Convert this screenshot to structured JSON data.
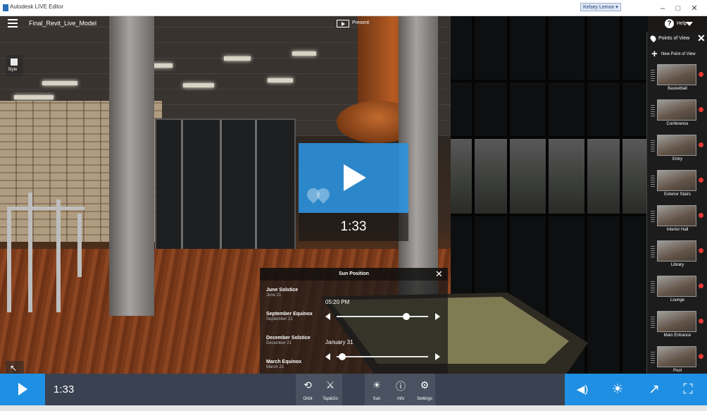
{
  "window": {
    "title": "Autodesk LIVE Editor",
    "user": "Kelsey Lemon ▾",
    "minimize": "–",
    "restore": "□",
    "close": "✕"
  },
  "header": {
    "model_name": "Final_Revit_Live_Model",
    "present_label": "Present",
    "help_glyph": "?",
    "help_label": "Help"
  },
  "style_button": {
    "label": "Style",
    "icon": "style-icon"
  },
  "points_of_view": {
    "title": "Points of View",
    "close_glyph": "✕",
    "new_label": "New Point of View",
    "plus_glyph": "+",
    "items": [
      {
        "label": "Basketball"
      },
      {
        "label": "Conference"
      },
      {
        "label": "Entry"
      },
      {
        "label": "Exterior Stairs"
      },
      {
        "label": "Interior Hall"
      },
      {
        "label": "Library"
      },
      {
        "label": "Lounge"
      },
      {
        "label": "Main Entrance"
      },
      {
        "label": "Pool"
      }
    ]
  },
  "playback": {
    "overlay_time": "1:33",
    "bottom_time": "1:33"
  },
  "sun_position": {
    "title": "Sun Position",
    "close_glyph": "✕",
    "presets": [
      {
        "name": "June Solstice",
        "date": "June 21"
      },
      {
        "name": "September Equinox",
        "date": "September 21"
      },
      {
        "name": "December Solstice",
        "date": "December 21"
      },
      {
        "name": "March Equinox",
        "date": "March 21"
      }
    ],
    "time_value": "05:20 PM",
    "time_fraction": 0.76,
    "date_value": "January 31",
    "date_fraction": 0.06
  },
  "toolbar": {
    "navigation": [
      {
        "label": "Orbit",
        "icon": "orbit-icon",
        "glyph": "⟲"
      },
      {
        "label": "Tap&Go",
        "icon": "walk-icon",
        "glyph": "⚔"
      }
    ],
    "settings": [
      {
        "label": "Sun",
        "icon": "sun-icon",
        "glyph": "☀"
      },
      {
        "label": "Info",
        "icon": "info-icon",
        "glyph": "ⓘ"
      },
      {
        "label": "Settings",
        "icon": "settings-icon",
        "glyph": "⚙"
      }
    ],
    "right": [
      {
        "icon": "volume-icon",
        "glyph": "◀)"
      },
      {
        "icon": "brightness-icon",
        "glyph": "☀"
      },
      {
        "icon": "share-icon",
        "glyph": "↗"
      },
      {
        "icon": "fullscreen-icon",
        "glyph": "⛶"
      }
    ]
  },
  "colors": {
    "accent": "#1f8fe3",
    "play_overlay": "#2b94e1",
    "bottom_bar": "#3a4150",
    "delete_dot": "#e53935"
  }
}
